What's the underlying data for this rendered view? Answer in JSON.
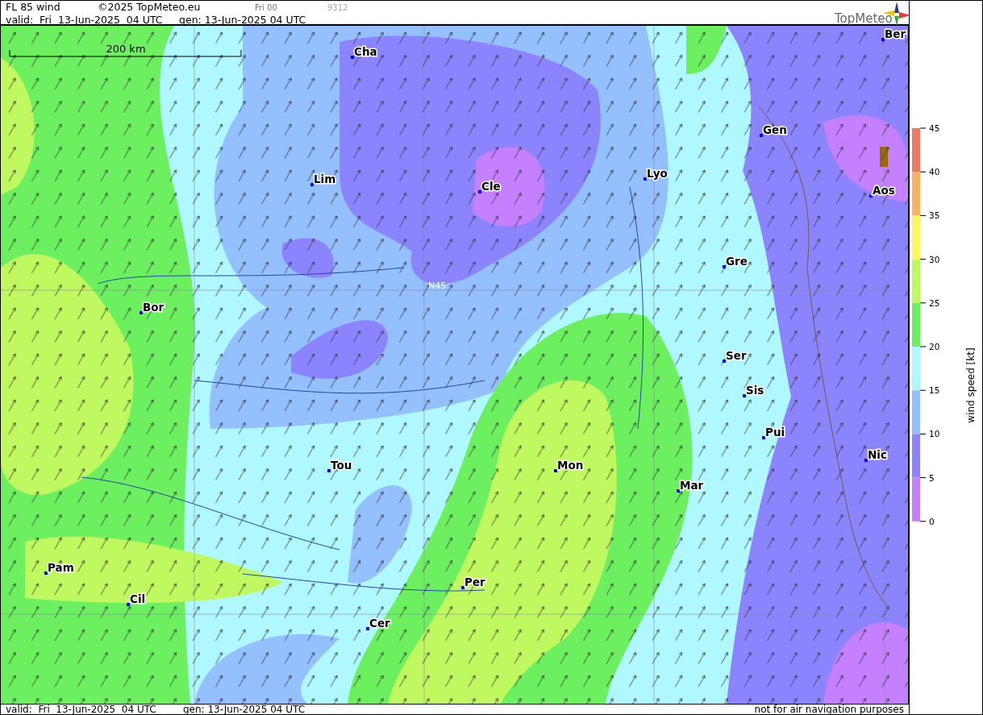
{
  "header": {
    "title": "FL 85 wind",
    "copyright": "©2025 TopMeteo.eu",
    "run": "Fri 00",
    "code": "9312",
    "valid": "valid:  Fri  13-Jun-2025  04 UTC",
    "generated": "gen: 13-Jun-2025 04 UTC",
    "logo": "TopMeteo"
  },
  "map": {
    "scale_label": "200 km",
    "grid_label": "N45",
    "cities": [
      {
        "name": "Ber"
      },
      {
        "name": "Cha"
      },
      {
        "name": "Gen"
      },
      {
        "name": "Lim"
      },
      {
        "name": "Lyo"
      },
      {
        "name": "Cle"
      },
      {
        "name": "Aos"
      },
      {
        "name": "Gre"
      },
      {
        "name": "Bor"
      },
      {
        "name": "Ser"
      },
      {
        "name": "Sis"
      },
      {
        "name": "Pui"
      },
      {
        "name": "Nic"
      },
      {
        "name": "Tou"
      },
      {
        "name": "Mon"
      },
      {
        "name": "Mar"
      },
      {
        "name": "Pam"
      },
      {
        "name": "Per"
      },
      {
        "name": "Cil"
      },
      {
        "name": "Cer"
      }
    ]
  },
  "legend": {
    "title": "wind speed [kt]",
    "ticks": [
      "45",
      "40",
      "35",
      "30",
      "25",
      "20",
      "15",
      "10",
      "5",
      "0"
    ],
    "bands": [
      {
        "color": "#f07860"
      },
      {
        "color": "#ffb060"
      },
      {
        "color": "#fff860"
      },
      {
        "color": "#c0f860"
      },
      {
        "color": "#6cf060"
      },
      {
        "color": "#b0f8ff"
      },
      {
        "color": "#94c0ff"
      },
      {
        "color": "#8c84ff"
      },
      {
        "color": "#c480ff"
      }
    ]
  },
  "footer": {
    "valid": "valid:  Fri  13-Jun-2025  04 UTC",
    "generated": "gen: 13-Jun-2025 04 UTC",
    "disclaimer": "not for air navigation purposes"
  }
}
